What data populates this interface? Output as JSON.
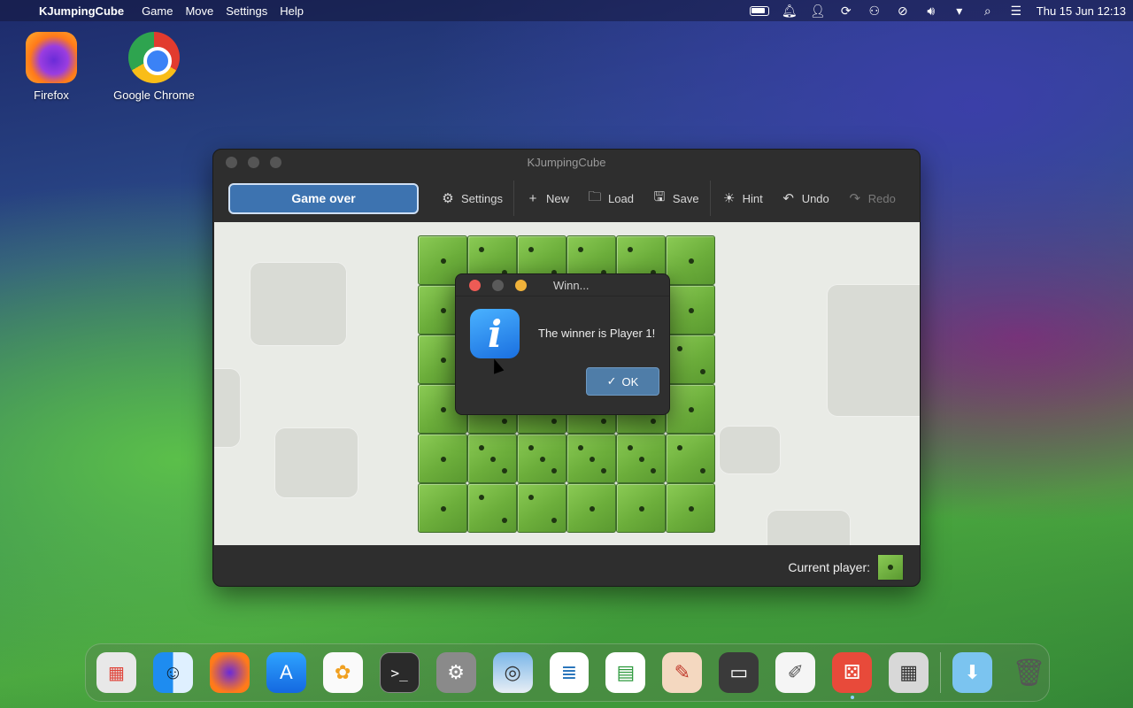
{
  "menubar": {
    "app_name": "KJumpingCube",
    "menus": [
      "Game",
      "Move",
      "Settings",
      "Help"
    ],
    "clock": "Thu 15 Jun 12:13"
  },
  "desktop": {
    "icons": [
      {
        "label": "Firefox"
      },
      {
        "label": "Google Chrome"
      }
    ]
  },
  "window": {
    "title": "KJumpingCube",
    "status_button": "Game over",
    "toolbar": {
      "settings": "Settings",
      "new": "New",
      "load": "Load",
      "save": "Save",
      "hint": "Hint",
      "undo": "Undo",
      "redo": "Redo"
    },
    "statusbar_label": "Current player:",
    "board": {
      "rows": 6,
      "cols": 6,
      "owner_color": "#74b845",
      "pips": [
        [
          1,
          2,
          2,
          2,
          2,
          1
        ],
        [
          1,
          2,
          2,
          2,
          2,
          1
        ],
        [
          1,
          2,
          2,
          2,
          2,
          2
        ],
        [
          1,
          2,
          2,
          2,
          2,
          1
        ],
        [
          1,
          3,
          3,
          3,
          3,
          2
        ],
        [
          1,
          2,
          2,
          1,
          1,
          1
        ]
      ]
    }
  },
  "dialog": {
    "title": "Winn...",
    "message": "The winner is Player 1!",
    "ok_label": "OK"
  },
  "colors": {
    "close": "#ee5b55",
    "minimize": "#5a5a5a",
    "zoom": "#f0b23a",
    "accent": "#3d73b0"
  },
  "dock": {
    "apps": [
      "launchpad",
      "finder",
      "firefox",
      "app-store",
      "photos",
      "terminal",
      "system-settings",
      "image-viewer",
      "writer",
      "calc",
      "drawing",
      "tape",
      "notes",
      "kjumpingcube",
      "calculator",
      "downloads",
      "trash"
    ]
  }
}
